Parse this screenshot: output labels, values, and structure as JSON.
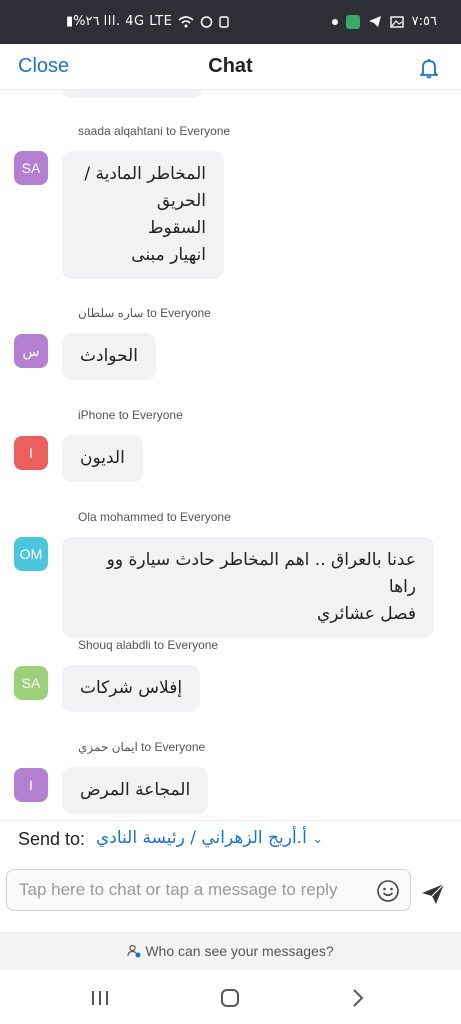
{
  "status_bar": {
    "left_text": "▮%٢٦ lll. 4G LTE",
    "time": "٧:٥٦"
  },
  "header": {
    "close_label": "Close",
    "title": "Chat"
  },
  "messages": [
    {
      "sender": "saada alqahtani to Everyone",
      "avatar_text": "SA",
      "avatar_color": "#b57fd1",
      "text": "المخاطر المادية /\nالحريق\nالسقوط\nانهيار مبنى"
    },
    {
      "sender": "ساره سلطان to Everyone",
      "avatar_text": "س",
      "avatar_color": "#b57fd1",
      "text": "الحوادث"
    },
    {
      "sender": "iPhone to Everyone",
      "avatar_text": "I",
      "avatar_color": "#ec5f5f",
      "text": "الديون"
    },
    {
      "sender": "Ola mohammed to Everyone",
      "avatar_text": "OM",
      "avatar_color": "#4cc6dc",
      "text": "عدنا بالعراق .. اهم المخاطر حادث سيارة وو راها\nفصل عشائري"
    },
    {
      "sender": "Shouq alabdli to Everyone",
      "avatar_text": "SA",
      "avatar_color": "#9dd07a",
      "text": "إفلاس شركات"
    },
    {
      "sender": "ايمان حمزي to Everyone",
      "avatar_text": "I",
      "avatar_color": "#b57fd1",
      "text": "المجاعة المرض"
    }
  ],
  "send_to": {
    "label": "Send to:",
    "value": "أ.أريج الزهراني / رئيسة النادي"
  },
  "input": {
    "placeholder": "Tap here to chat or tap a message to reply"
  },
  "privacy_link": "Who can see your messages?",
  "icons": {
    "bell": "bell-icon",
    "emoji": "emoji-icon",
    "send": "send-icon",
    "privacy": "person-lock-icon",
    "nav_recents": "recents-icon",
    "nav_home": "home-icon",
    "nav_back": "back-icon"
  },
  "colors": {
    "accent": "#1a74c6",
    "status_bar_bg": "#2f3037",
    "bubble_bg": "#f2f2f4"
  }
}
